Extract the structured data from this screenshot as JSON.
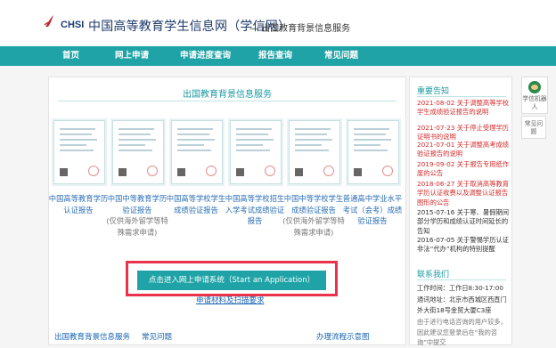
{
  "header": {
    "logo_text": "CHSI",
    "title": "中国高等教育学生信息网（学信网）",
    "subtitle": "— 出国教育背景信息服务"
  },
  "nav": {
    "items": [
      "首页",
      "网上申请",
      "申请进度查询",
      "报告查询",
      "常见问题"
    ]
  },
  "main": {
    "title": "出国教育背景信息服务",
    "documents": [
      {
        "label": "中国高等教育学历认证报告",
        "note": ""
      },
      {
        "label": "中国中等教育学历验证报告",
        "note": "(仅供海外留学等特殊需求申请)"
      },
      {
        "label": "中国高等学校学生成绩验证报告",
        "note": ""
      },
      {
        "label": "中国高等学校招生入学考试成绩验证报告",
        "note": ""
      },
      {
        "label": "中国中等学校学生成绩验证报告",
        "note": "(仅供海外留学等特殊需求申请)"
      },
      {
        "label": "普通高中学业水平考试（会考）成绩验证报告",
        "note": ""
      }
    ],
    "cta_label": "点击进入网上申请系统（Start an Application）",
    "requirements_link": "申请材料及扫描要求",
    "footer_left": "出国教育背景信息服务",
    "footer_mid": "常见问题",
    "footer_right": "办理流程示意图"
  },
  "sidebar": {
    "news_title": "重要告知",
    "news": [
      {
        "text": "2021-08-02 关于调整高等学校学生成绩验证报告的说明",
        "color": "red"
      },
      {
        "text": "2021-07-23 关于停止受理学历证明书的说明",
        "color": "red"
      },
      {
        "text": "2021-07-01 关于调整高考成绩验证报告的说明",
        "color": "red"
      },
      {
        "text": "2019-09-02 关于报告专用纸作废的公告",
        "color": "red"
      },
      {
        "text": "2018-06-27 关于取消高等教育学历认证收费以及调整认证报告图形的公告",
        "color": "red"
      },
      {
        "text": "2015-07-16 关于寒、暑假期间部分学历和成绩认证时间延长的告知",
        "color": "black"
      },
      {
        "text": "2016-07-05 关于警惕学历认证非法“代办”机构的特别提醒",
        "color": "black"
      }
    ],
    "contact_title": "联系我们",
    "contact": [
      "工作时间：工作日8:30-17:00",
      "通讯地址：北京市西城区西直门外大街18号金贸大厦C3座",
      "由于进行电话咨询的用户较多，因此建议您登录后在“我的咨询”中提交"
    ]
  },
  "float": {
    "bot_label": "学信机器人",
    "faq_label": "常见问题"
  },
  "colors": {
    "accent": "#1fa3a6",
    "alert": "#e8334b",
    "link": "#1563b3"
  }
}
